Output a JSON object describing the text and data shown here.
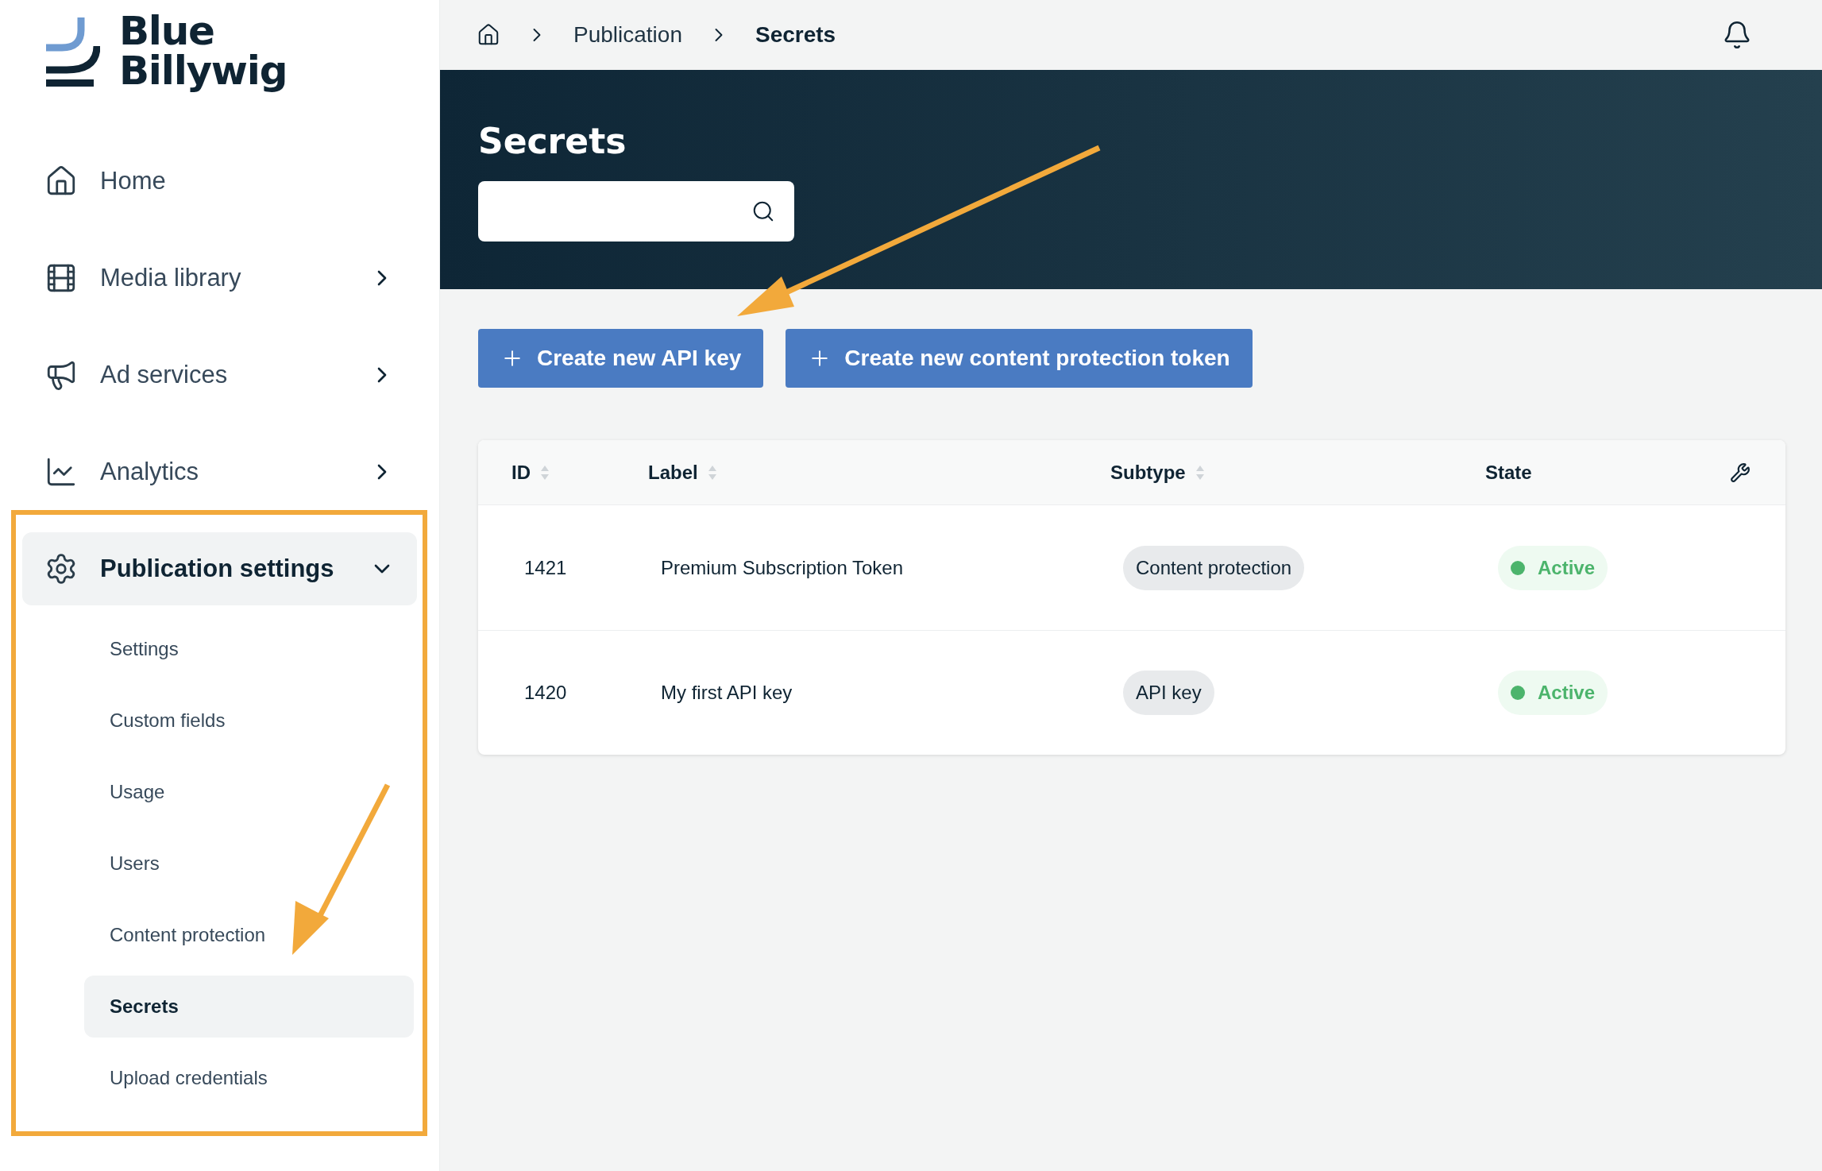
{
  "sidebar": {
    "logo": {
      "lines": [
        "Blue",
        "Billywig"
      ]
    },
    "items": [
      {
        "kind": "link",
        "label": "Home"
      },
      {
        "kind": "group",
        "label": "Media library",
        "expanded": false
      },
      {
        "kind": "group",
        "label": "Ad services",
        "expanded": false
      },
      {
        "kind": "group",
        "label": "Analytics",
        "expanded": false
      },
      {
        "kind": "group",
        "label": "Publication settings",
        "expanded": true,
        "children": [
          {
            "label": "Settings",
            "selected": false
          },
          {
            "label": "Custom fields",
            "selected": false
          },
          {
            "label": "Usage",
            "selected": false
          },
          {
            "label": "Users",
            "selected": false
          },
          {
            "label": "Content protection",
            "selected": false
          },
          {
            "label": "Secrets",
            "selected": true
          },
          {
            "label": "Upload credentials",
            "selected": false
          }
        ]
      }
    ]
  },
  "breadcrumb": [
    {
      "label": "Publication",
      "current": false
    },
    {
      "label": "Secrets",
      "current": true
    }
  ],
  "header": {
    "title": "Secrets"
  },
  "buttons": [
    {
      "label": "Create new API key"
    },
    {
      "label": "Create new content protection token"
    }
  ],
  "table": {
    "columns": [
      {
        "label": "ID",
        "sortable": true
      },
      {
        "label": "Label",
        "sortable": true
      },
      {
        "label": "Subtype",
        "sortable": true
      },
      {
        "label": "State",
        "sortable": false
      }
    ],
    "rows": [
      {
        "id": "1421",
        "label": "Premium Subscription Token",
        "subtype": "Content protection",
        "state": {
          "label": "Active",
          "color": "#4cb46c"
        }
      },
      {
        "id": "1420",
        "label": "My first API key",
        "subtype": "API key",
        "state": {
          "label": "Active",
          "color": "#4cb46c"
        }
      }
    ]
  }
}
